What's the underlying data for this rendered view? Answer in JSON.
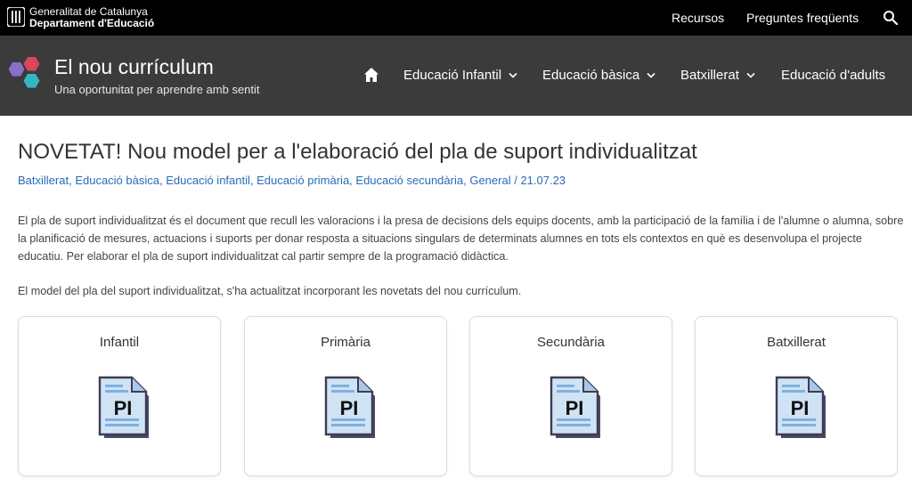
{
  "topbar": {
    "org_line1": "Generalitat de Catalunya",
    "org_line2": "Departament d'Educació",
    "links": [
      "Recursos",
      "Preguntes freqüents"
    ]
  },
  "header": {
    "title": "El nou currículum",
    "tagline": "Una oportunitat per aprendre amb sentit",
    "nav": [
      "Educació Infantil",
      "Educació bàsica",
      "Batxillerat",
      "Educació d'adults"
    ]
  },
  "post": {
    "title": "NOVETAT! Nou model per a l'elaboració del pla de suport individualitzat",
    "categories": [
      "Batxillerat",
      "Educació bàsica",
      "Educació infantil",
      "Educació primària",
      "Educació secundària",
      "General"
    ],
    "date": "21.07.23",
    "paragraph1": "El pla de suport individualitzat és el document que recull les valoracions i la presa de decisions dels equips docents, amb la participació de la família i de l'alumne o alumna, sobre la planificació de mesures, actuacions i suports per donar resposta a situacions singulars de determinats alumnes en tots els contextos en què es desenvolupa el projecte educatiu. Per elaborar el pla de suport individualitzat cal partir sempre de la programació didàctica.",
    "paragraph2": "El model del pla del suport individualitzat, s'ha actualitzat incorporant les novetats del nou currículum."
  },
  "cards": [
    {
      "title": "Infantil",
      "icon_label": "PI"
    },
    {
      "title": "Primària",
      "icon_label": "PI"
    },
    {
      "title": "Secundària",
      "icon_label": "PI"
    },
    {
      "title": "Batxillerat",
      "icon_label": "PI"
    }
  ],
  "colors": {
    "topbar_bg": "#000000",
    "header_bg": "#3b3b3b",
    "link_blue": "#2a6bb8",
    "logo_purple": "#8a6fc9",
    "logo_red": "#d9475a",
    "logo_teal": "#35b6c2"
  }
}
